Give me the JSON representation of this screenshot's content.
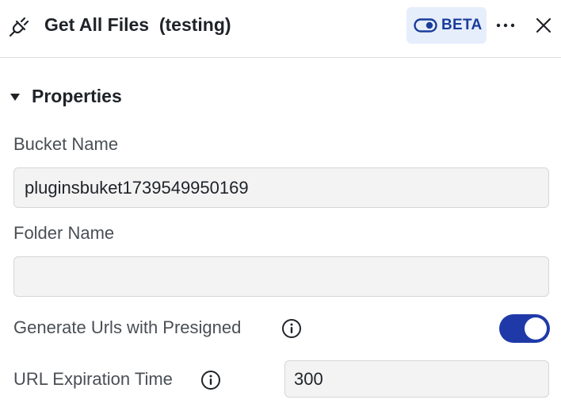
{
  "header": {
    "title": "Get All Files  (testing)",
    "icon": "plug-icon",
    "beta_label": "BETA",
    "beta_icon": "toggle-icon",
    "more_icon": "more-horizontal-icon",
    "close_icon": "close-icon"
  },
  "section": {
    "title": "Properties",
    "expanded": true
  },
  "fields": {
    "bucket_name": {
      "label": "Bucket Name",
      "value": "pluginsbuket1739549950169"
    },
    "folder_name": {
      "label": "Folder Name",
      "value": ""
    },
    "generate_urls": {
      "label": "Generate Urls with Presigned",
      "enabled": true
    },
    "url_expiration": {
      "label": "URL Expiration Time",
      "value": "300"
    }
  },
  "colors": {
    "accent": "#1f3aa8",
    "beta_bg": "#e6eefc",
    "beta_text": "#1a3d9b",
    "input_bg": "#f3f3f3"
  }
}
